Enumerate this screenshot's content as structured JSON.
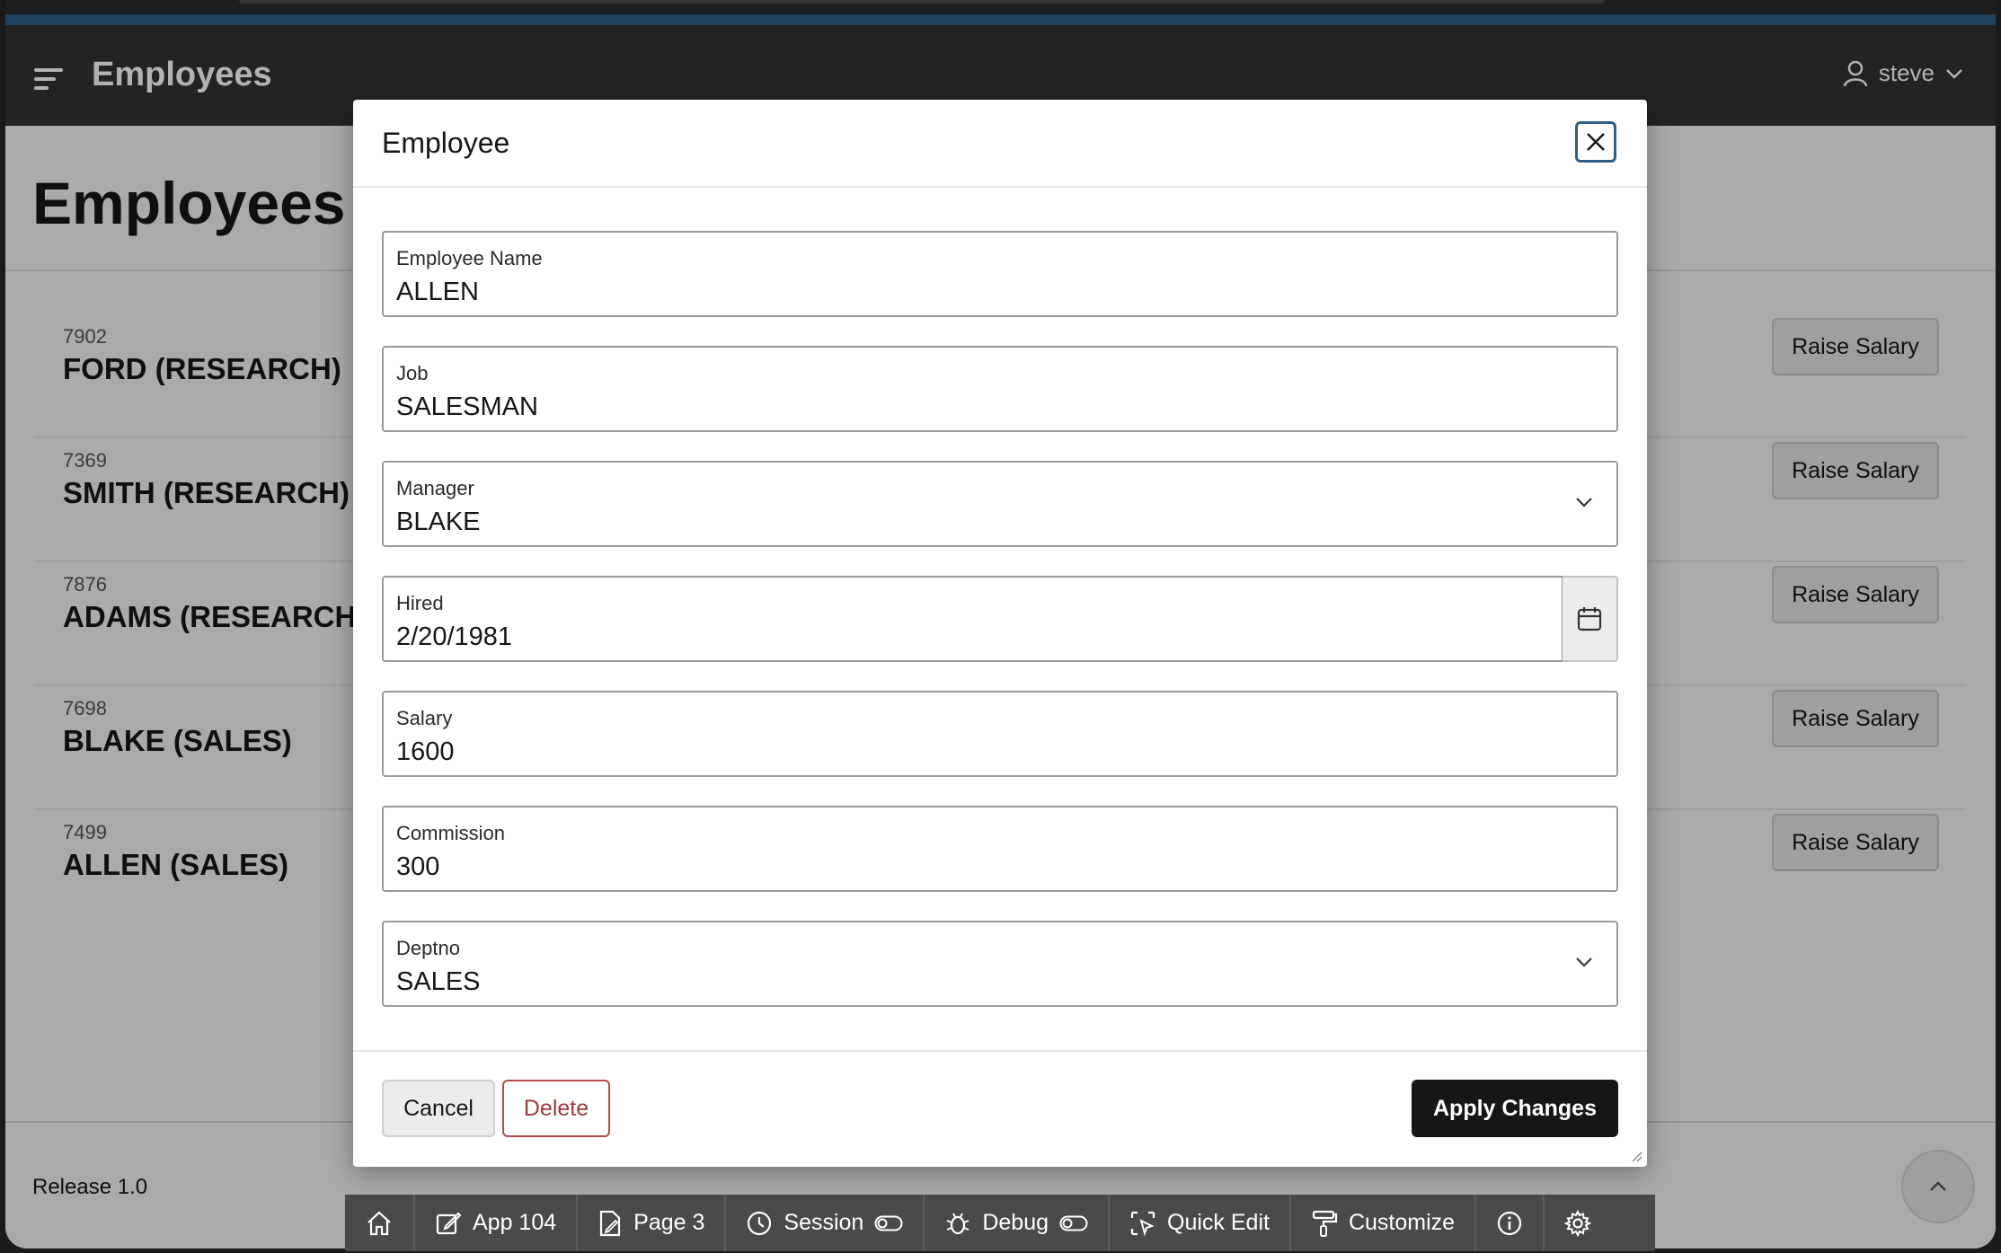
{
  "header": {
    "app_title": "Employees",
    "user": "steve"
  },
  "page": {
    "title": "Employees",
    "release": "Release 1.0"
  },
  "employees": [
    {
      "id": "7902",
      "name": "FORD (RESEARCH)",
      "action": "Raise Salary"
    },
    {
      "id": "7369",
      "name": "SMITH (RESEARCH)",
      "action": "Raise Salary"
    },
    {
      "id": "7876",
      "name": "ADAMS (RESEARCH)",
      "action": "Raise Salary"
    },
    {
      "id": "7698",
      "name": "BLAKE (SALES)",
      "action": "Raise Salary"
    },
    {
      "id": "7499",
      "name": "ALLEN (SALES)",
      "action": "Raise Salary"
    }
  ],
  "modal": {
    "title": "Employee",
    "fields": {
      "ename": {
        "label": "Employee Name",
        "value": "ALLEN"
      },
      "job": {
        "label": "Job",
        "value": "SALESMAN"
      },
      "mgr": {
        "label": "Manager",
        "value": "BLAKE"
      },
      "hired": {
        "label": "Hired",
        "value": "2/20/1981"
      },
      "sal": {
        "label": "Salary",
        "value": "1600"
      },
      "comm": {
        "label": "Commission",
        "value": "300"
      },
      "deptno": {
        "label": "Deptno",
        "value": "SALES"
      }
    },
    "buttons": {
      "cancel": "Cancel",
      "delete": "Delete",
      "apply": "Apply Changes"
    }
  },
  "devbar": {
    "app": "App 104",
    "page": "Page 3",
    "session": "Session",
    "debug": "Debug",
    "quick_edit": "Quick Edit",
    "customize": "Customize"
  },
  "colors": {
    "header_bg": "#333333",
    "accent": "#2e5f86",
    "apply_bg": "#161616",
    "delete": "#9c3b3b"
  }
}
